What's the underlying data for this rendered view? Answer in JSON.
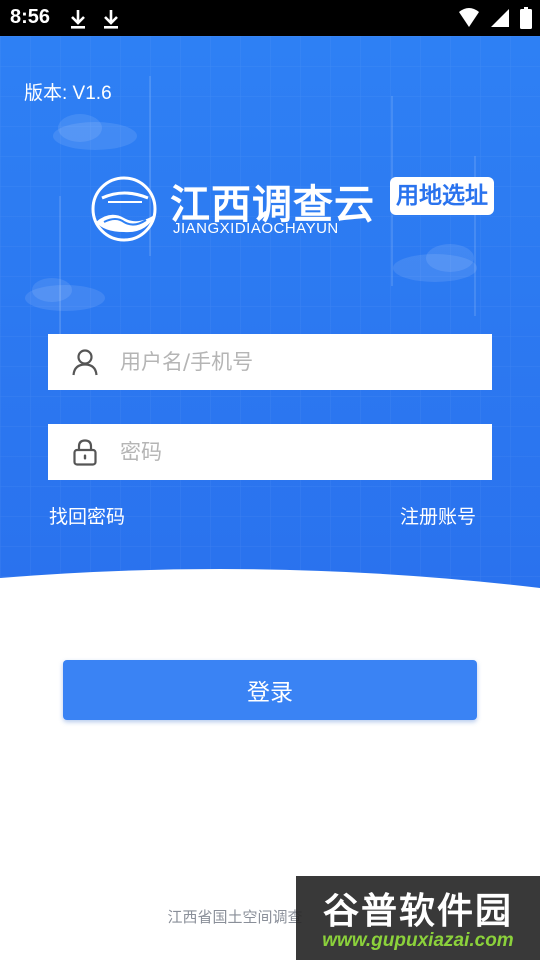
{
  "status_bar": {
    "time": "8:56",
    "icons": [
      "download-icon",
      "download-icon",
      "wifi-icon",
      "signal-icon",
      "battery-icon"
    ]
  },
  "header": {
    "version": "版本: V1.6",
    "brand_name": "江西调查云",
    "brand_pinyin": "JIANGXIDIAOCHAYUN",
    "brand_tag": "用地选址"
  },
  "form": {
    "username_placeholder": "用户名/手机号",
    "password_placeholder": "密码",
    "forgot_label": "找回密码",
    "register_label": "注册账号",
    "login_label": "登录"
  },
  "footer": {
    "text": "江西省国土空间调查"
  },
  "watermark": {
    "title": "谷普软件园",
    "url": "www.gupuxiazai.com"
  },
  "colors": {
    "hero_top": "#2e80f4",
    "hero_bottom": "#2a73ee",
    "button": "#3a83f4",
    "tag_text": "#2a73ee"
  }
}
